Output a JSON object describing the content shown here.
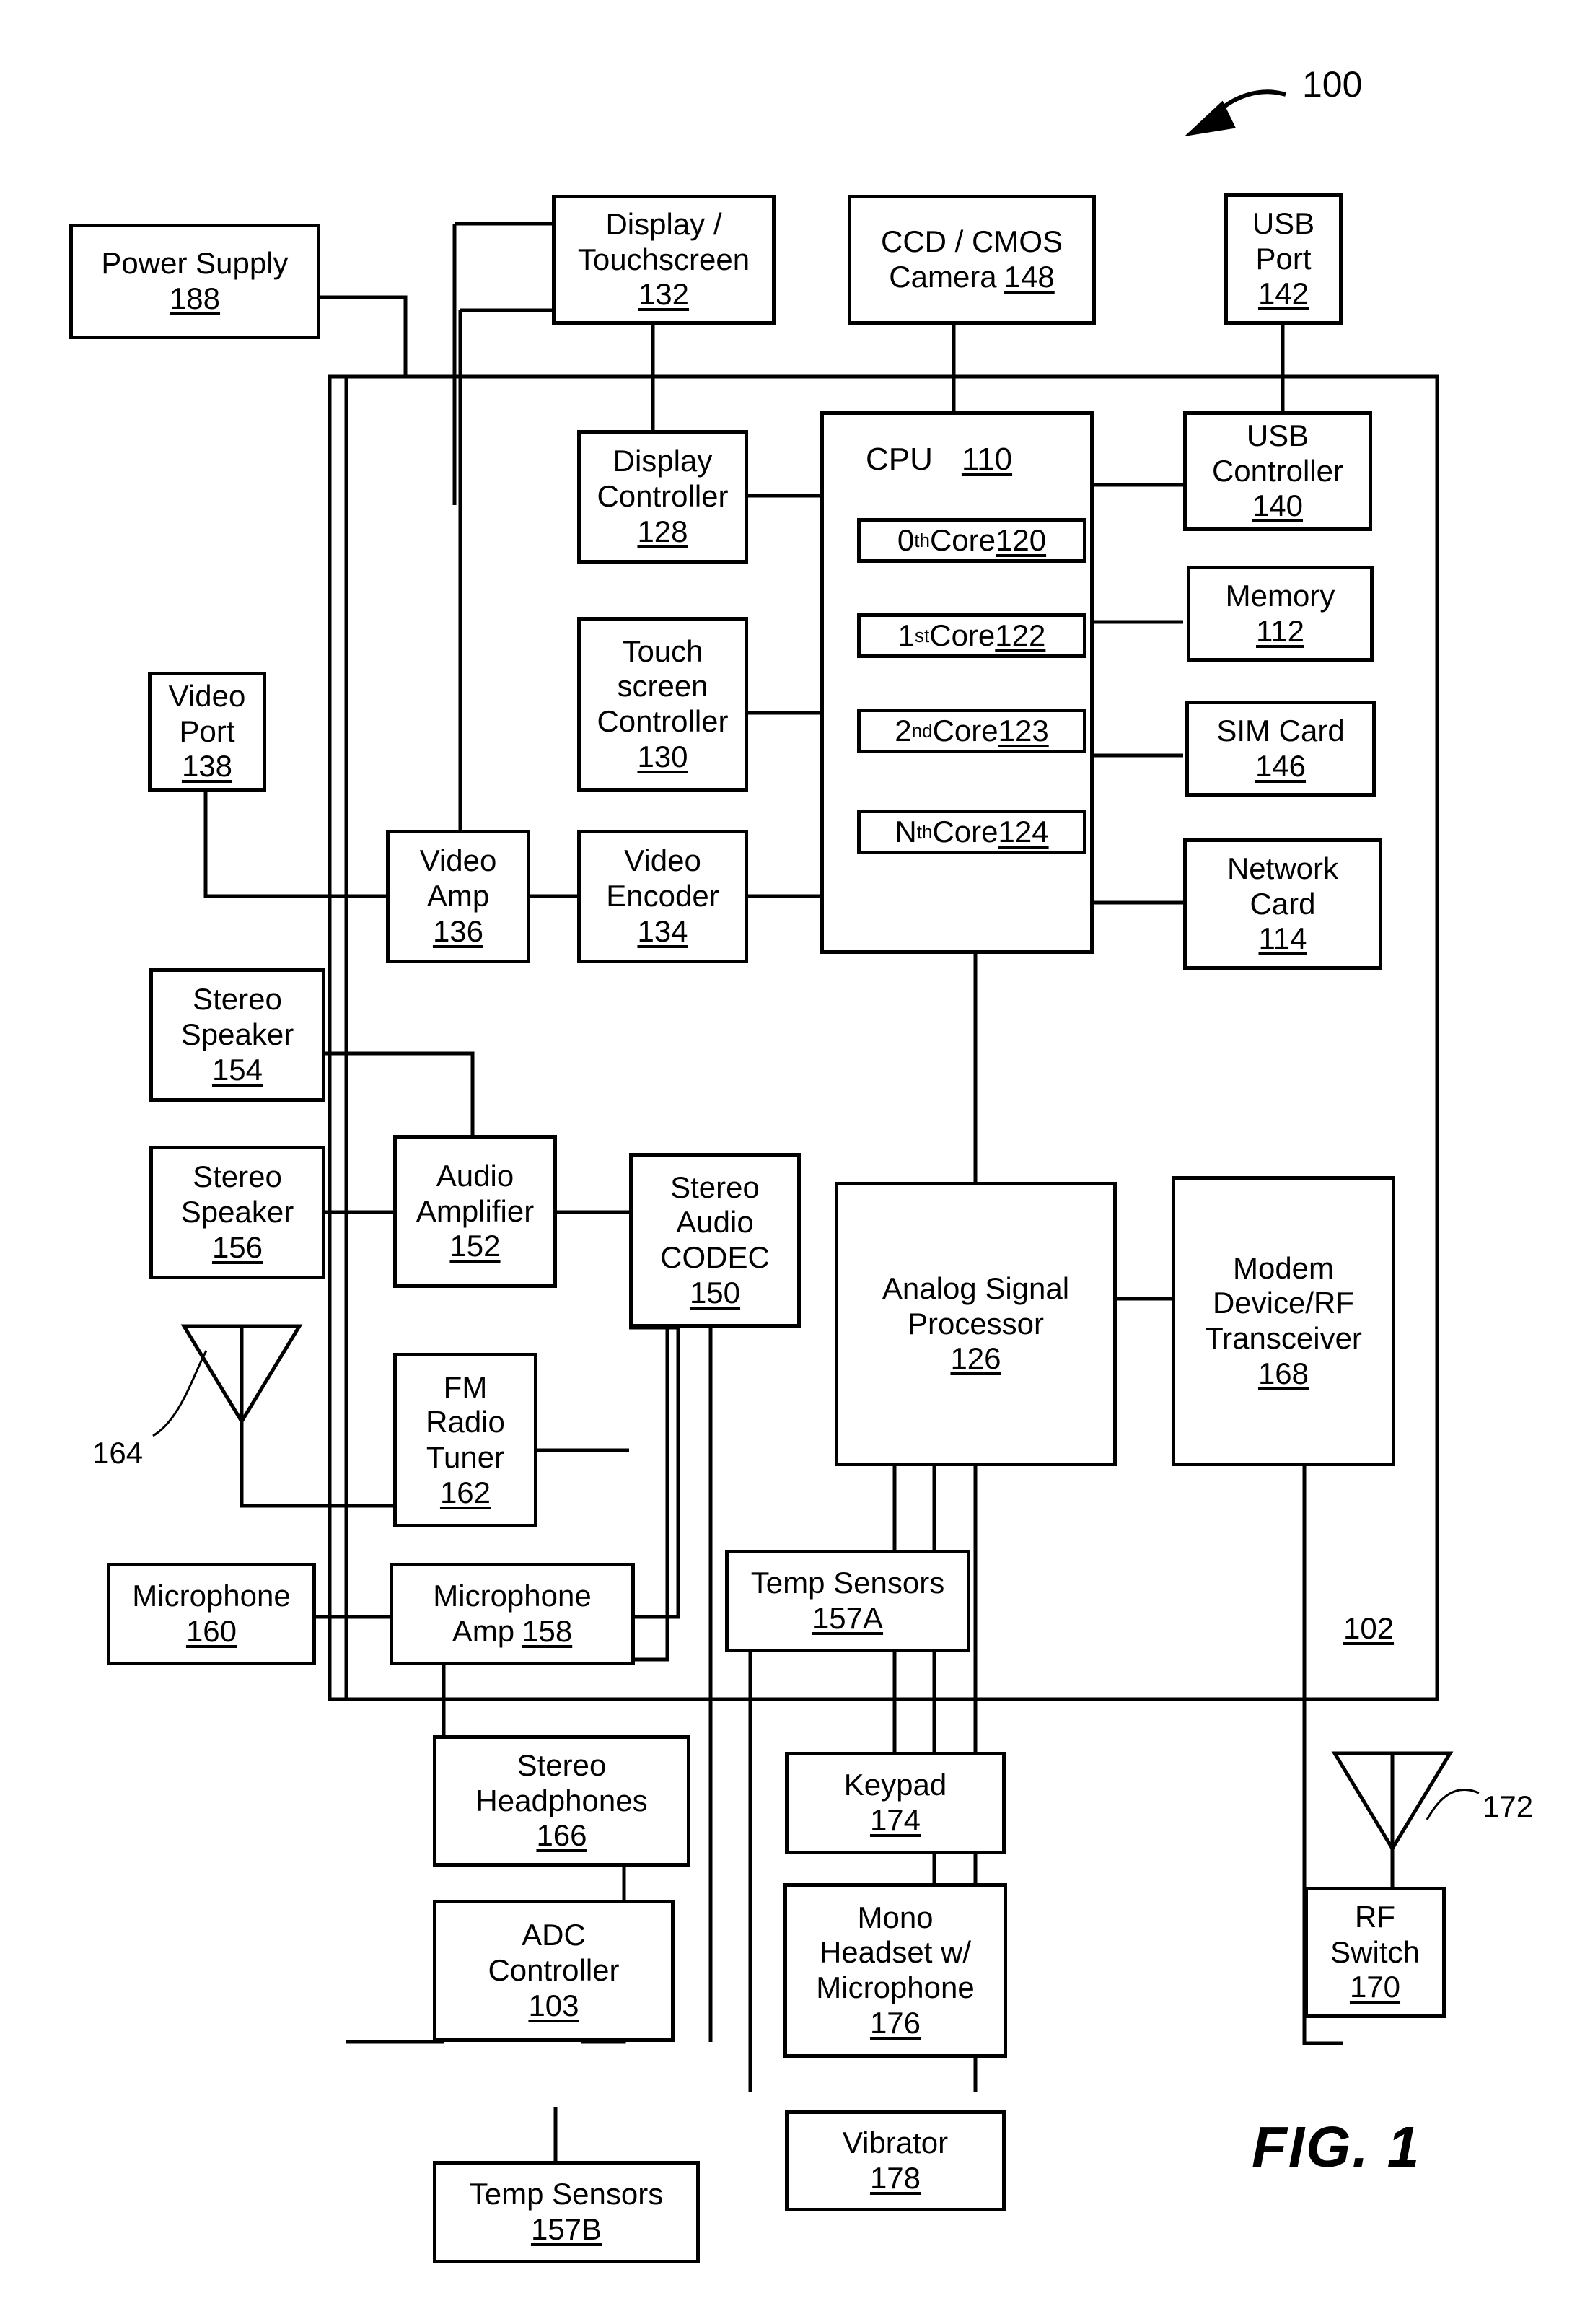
{
  "figure": {
    "label": "FIG.  1",
    "system_ref": "100",
    "chip_boundary_ref": "102"
  },
  "antennas": [
    {
      "name": "fm-antenna",
      "ref": "164"
    },
    {
      "name": "rf-antenna",
      "ref": "172"
    }
  ],
  "cpu": {
    "title": "CPU",
    "ref": "110",
    "cores": [
      {
        "ordinal": "0",
        "suffix": "th",
        "label": " Core ",
        "ref": "120"
      },
      {
        "ordinal": "1",
        "suffix": "st",
        "label": " Core ",
        "ref": "122"
      },
      {
        "ordinal": "2",
        "suffix": "nd",
        "label": " Core ",
        "ref": "123"
      },
      {
        "ordinal": "N",
        "suffix": "th",
        "label": " Core ",
        "ref": "124"
      }
    ]
  },
  "blocks": {
    "power_supply": {
      "lines": [
        "Power Supply"
      ],
      "ref": "188"
    },
    "display_touchscreen": {
      "lines": [
        "Display /",
        "Touchscreen"
      ],
      "ref": "132"
    },
    "ccd_cmos_camera": {
      "lines": [
        "CCD / CMOS",
        "Camera"
      ],
      "ref": "148",
      "inline_ref": true
    },
    "usb_port": {
      "lines": [
        "USB",
        "Port"
      ],
      "ref": "142"
    },
    "display_controller": {
      "lines": [
        "Display",
        "Controller"
      ],
      "ref": "128"
    },
    "usb_controller": {
      "lines": [
        "USB",
        "Controller"
      ],
      "ref": "140"
    },
    "memory": {
      "lines": [
        "Memory"
      ],
      "ref": "112"
    },
    "sim_card": {
      "lines": [
        "SIM Card"
      ],
      "ref": "146"
    },
    "network_card": {
      "lines": [
        "Network",
        "Card"
      ],
      "ref": "114"
    },
    "touchscreen_controller": {
      "lines": [
        "Touch",
        "screen",
        "Controller"
      ],
      "ref": "130"
    },
    "video_port": {
      "lines": [
        "Video",
        "Port"
      ],
      "ref": "138"
    },
    "video_amp": {
      "lines": [
        "Video",
        "Amp"
      ],
      "ref": "136"
    },
    "video_encoder": {
      "lines": [
        "Video",
        "Encoder"
      ],
      "ref": "134"
    },
    "stereo_speaker_154": {
      "lines": [
        "Stereo",
        "Speaker"
      ],
      "ref": "154"
    },
    "stereo_speaker_156": {
      "lines": [
        "Stereo",
        "Speaker"
      ],
      "ref": "156"
    },
    "audio_amplifier": {
      "lines": [
        "Audio",
        "Amplifier"
      ],
      "ref": "152"
    },
    "stereo_audio_codec": {
      "lines": [
        "Stereo",
        "Audio",
        "CODEC"
      ],
      "ref": "150"
    },
    "analog_signal_processor": {
      "lines": [
        "Analog Signal",
        "Processor"
      ],
      "ref": "126"
    },
    "modem_rf_transceiver": {
      "lines": [
        "Modem",
        "Device/RF",
        "Transceiver"
      ],
      "ref": "168"
    },
    "fm_radio_tuner": {
      "lines": [
        "FM",
        "Radio",
        "Tuner"
      ],
      "ref": "162"
    },
    "microphone": {
      "lines": [
        "Microphone"
      ],
      "ref": "160"
    },
    "microphone_amp": {
      "lines": [
        "Microphone",
        "Amp"
      ],
      "ref": "158",
      "inline_ref": true
    },
    "temp_sensors_157a": {
      "lines": [
        "Temp Sensors"
      ],
      "ref": "157A"
    },
    "stereo_headphones": {
      "lines": [
        "Stereo",
        "Headphones"
      ],
      "ref": "166"
    },
    "keypad": {
      "lines": [
        "Keypad"
      ],
      "ref": "174"
    },
    "adc_controller": {
      "lines": [
        "ADC",
        "Controller"
      ],
      "ref": "103"
    },
    "mono_headset": {
      "lines": [
        "Mono",
        "Headset w/",
        "Microphone"
      ],
      "ref": "176"
    },
    "rf_switch": {
      "lines": [
        "RF",
        "Switch"
      ],
      "ref": "170"
    },
    "temp_sensors_157b": {
      "lines": [
        "Temp Sensors"
      ],
      "ref": "157B"
    },
    "vibrator": {
      "lines": [
        "Vibrator"
      ],
      "ref": "178"
    }
  }
}
